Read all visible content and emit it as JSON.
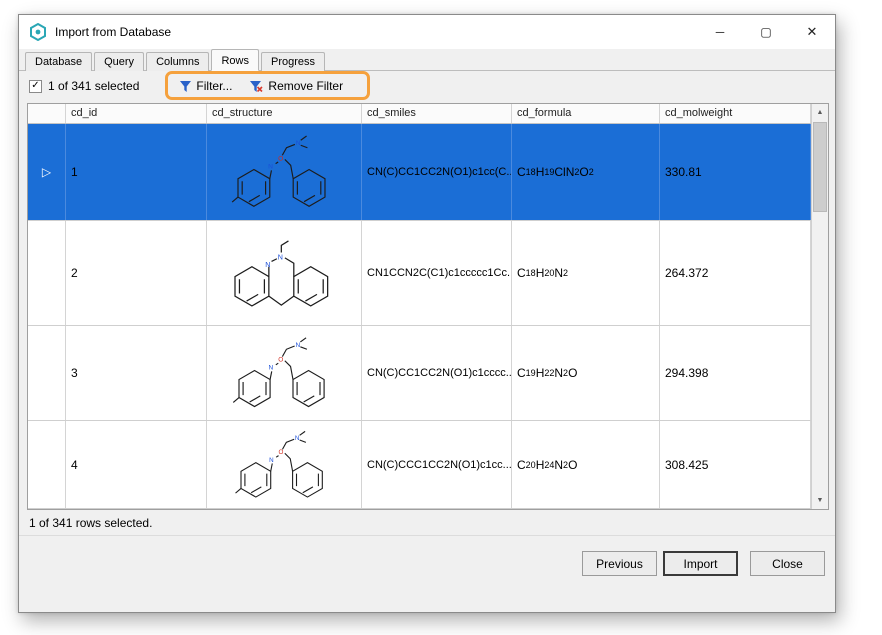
{
  "window": {
    "title": "Import from Database"
  },
  "icons": {
    "minimize": "─",
    "maximize": "▢",
    "close": "✕",
    "scroll_up": "▲",
    "scroll_down": "▼",
    "row_marker": "▷",
    "checkbox_check": "✓"
  },
  "tabs": [
    {
      "label": "Database"
    },
    {
      "label": "Query"
    },
    {
      "label": "Columns"
    },
    {
      "label": "Rows",
      "active": true
    },
    {
      "label": "Progress"
    }
  ],
  "toolbar": {
    "selection_label": "1 of 341 selected",
    "filter_label": "Filter...",
    "remove_filter_label": "Remove Filter"
  },
  "grid": {
    "columns": [
      "cd_id",
      "cd_structure",
      "cd_smiles",
      "cd_formula",
      "cd_molweight"
    ],
    "rows": [
      {
        "cd_id": "1",
        "cd_smiles": "CN(C)CC1CC2N(O1)c1cc(C...",
        "cd_formula": "C18H19ClN2O2",
        "cd_molweight": "330.81",
        "selected": true
      },
      {
        "cd_id": "2",
        "cd_smiles": "CN1CCN2C(C1)c1ccccc1Cc...",
        "cd_formula": "C18H20N2",
        "cd_molweight": "264.372",
        "selected": false
      },
      {
        "cd_id": "3",
        "cd_smiles": "CN(C)CC1CC2N(O1)c1cccc...",
        "cd_formula": "C19H22N2O",
        "cd_molweight": "294.398",
        "selected": false
      },
      {
        "cd_id": "4",
        "cd_smiles": "CN(C)CCC1CC2N(O1)c1cc...",
        "cd_formula": "C20H24N2O",
        "cd_molweight": "308.425",
        "selected": false
      }
    ]
  },
  "status": "1 of 341 rows selected.",
  "footer": {
    "previous": "Previous",
    "import": "Import",
    "close": "Close"
  },
  "colors": {
    "selection_blue": "#1b6ed6",
    "annotation_orange": "#f5a13d",
    "filter_icon_blue": "#2a62c9",
    "remove_filter_red": "#d83a2e",
    "app_icon_teal": "#2aa7b5"
  }
}
